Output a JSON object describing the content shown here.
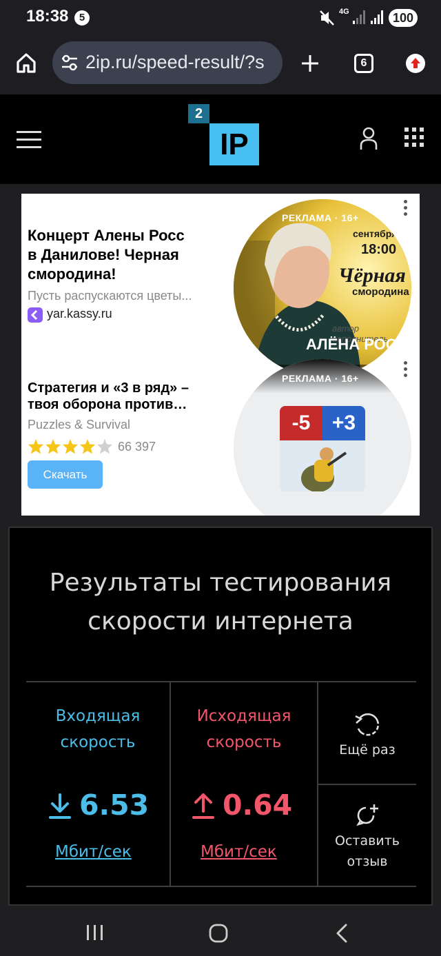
{
  "status_bar": {
    "time": "18:38",
    "notification_badge": "5",
    "network_type": "4G",
    "battery": "100"
  },
  "browser": {
    "url": "2ip.ru/speed-result/?s",
    "tab_count": "6",
    "icons": [
      "home-icon",
      "site-settings-icon",
      "new-tab-icon",
      "tabs-icon",
      "update-icon"
    ]
  },
  "site_header": {
    "logo_small": "2",
    "logo_main": "IP",
    "icons": [
      "menu-icon",
      "user-icon",
      "apps-grid-icon"
    ]
  },
  "ads": [
    {
      "title_line1": "Концерт Алены Росс",
      "title_line2": "в Данилове! Черная",
      "title_line3": "смородина!",
      "description": "Пусть распускаются цветы...",
      "domain": "yar.kassy.ru",
      "badge": "РЕКЛАМА · 16+",
      "image_texts": {
        "month": "сентября",
        "time": "18:00",
        "show_line1": "Чёрная",
        "show_line2": "смородина",
        "author_note": "автор исполнитель",
        "artist": "АЛЁНА РОС"
      }
    },
    {
      "title_line1": "Стратегия и «3 в ряд» –",
      "title_line2": "твоя оборона против…",
      "publisher": "Puzzles & Survival",
      "rating": 4.5,
      "rating_count": "66 397",
      "button": "Скачать",
      "badge": "РЕКЛАМА · 16+",
      "image_texts": {
        "minus": "-5",
        "plus": "+3"
      }
    }
  ],
  "results": {
    "title_line1": "Результаты тестирования",
    "title_line2": "скорости интернета",
    "download": {
      "label_line1": "Входящая",
      "label_line2": "скорость",
      "value": "6.53",
      "unit": "Мбит/сек",
      "color": "#4cbde9"
    },
    "upload": {
      "label_line1": "Исходящая",
      "label_line2": "скорость",
      "value": "0.64",
      "unit": "Мбит/сек",
      "color": "#f2566b"
    },
    "retry_label": "Ещё раз",
    "feedback_line1": "Оставить",
    "feedback_line2": "отзыв"
  },
  "nav_bar": {
    "icons": [
      "recent-apps-icon",
      "home-button-icon",
      "back-icon"
    ]
  }
}
